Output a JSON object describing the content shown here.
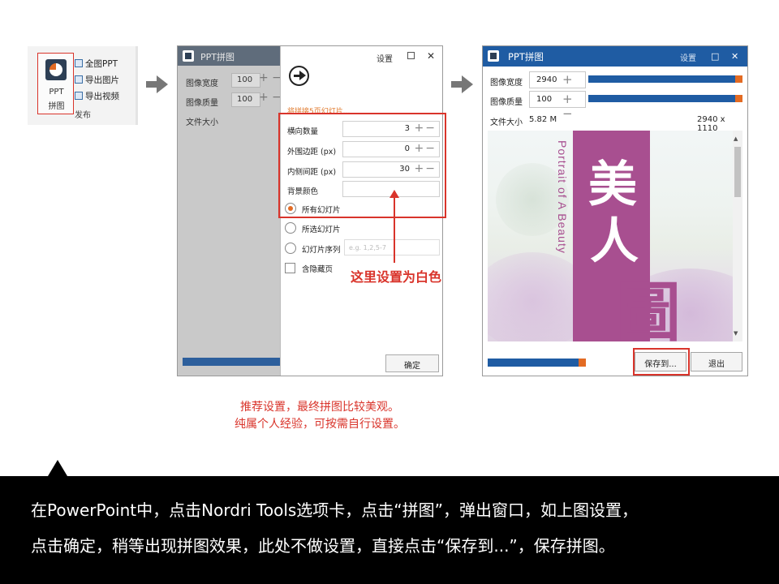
{
  "ribbon": {
    "button_label_line1": "PPT",
    "button_label_line2": "拼图",
    "menu_items": [
      {
        "label": "全图PPT",
        "icon": "full-ppt-icon"
      },
      {
        "label": "导出图片",
        "icon": "export-image-icon"
      },
      {
        "label": "导出视频",
        "icon": "export-video-icon"
      }
    ],
    "group_label": "发布"
  },
  "window1": {
    "title": "PPT拼图",
    "settings_label": "设置",
    "left_panel": {
      "width_label": "图像宽度",
      "width_value": "100",
      "quality_label": "图像质量",
      "quality_value": "100",
      "filesize_label": "文件大小"
    },
    "settings_panel": {
      "note": "将拼接5页幻灯片...",
      "fields": [
        {
          "label": "横向数量",
          "value": "3"
        },
        {
          "label": "外围边距 (px)",
          "value": "0"
        },
        {
          "label": "内侧间距 (px)",
          "value": "30"
        },
        {
          "label": "背景颜色",
          "value": ""
        }
      ],
      "options": [
        {
          "label": "所有幻灯片",
          "checked": true
        },
        {
          "label": "所选幻灯片",
          "checked": false
        },
        {
          "label": "幻灯片序列",
          "checked": false
        }
      ],
      "sequence_placeholder": "e.g. 1,2,5-7",
      "hide_hidden_label": "含隐藏页",
      "ok_button": "确定"
    }
  },
  "annotation": {
    "red_note": "这里设置为白色",
    "caption_line1": "推荐设置，最终拼图比较美观。",
    "caption_line2": "纯属个人经验，可按需自行设置。"
  },
  "window2": {
    "title": "PPT拼图",
    "settings_label": "设置",
    "width_label": "图像宽度",
    "width_value": "2940",
    "quality_label": "图像质量",
    "quality_value": "100",
    "filesize_label": "文件大小",
    "filesize_value": "5.82 M",
    "dimensions": "2940 x 1110",
    "preview": {
      "vertical_text": "Portrait of A Beauty",
      "calligraphy": [
        "美",
        "人",
        "圖"
      ]
    },
    "save_button": "保存到...",
    "exit_button": "退出"
  },
  "instructions": {
    "line1": "在PowerPoint中，点击Nordri Tools选项卡，点击“拼图”，弹出窗口，如上图设置，",
    "line2": "点击确定，稍等出现拼图效果，此处不做设置，直接点击“保存到...”，保存拼图。"
  },
  "colors": {
    "accent_red": "#d9342b",
    "title_blue": "#1f5ca3",
    "orange": "#e36b23",
    "band_purple": "#a84f90"
  }
}
